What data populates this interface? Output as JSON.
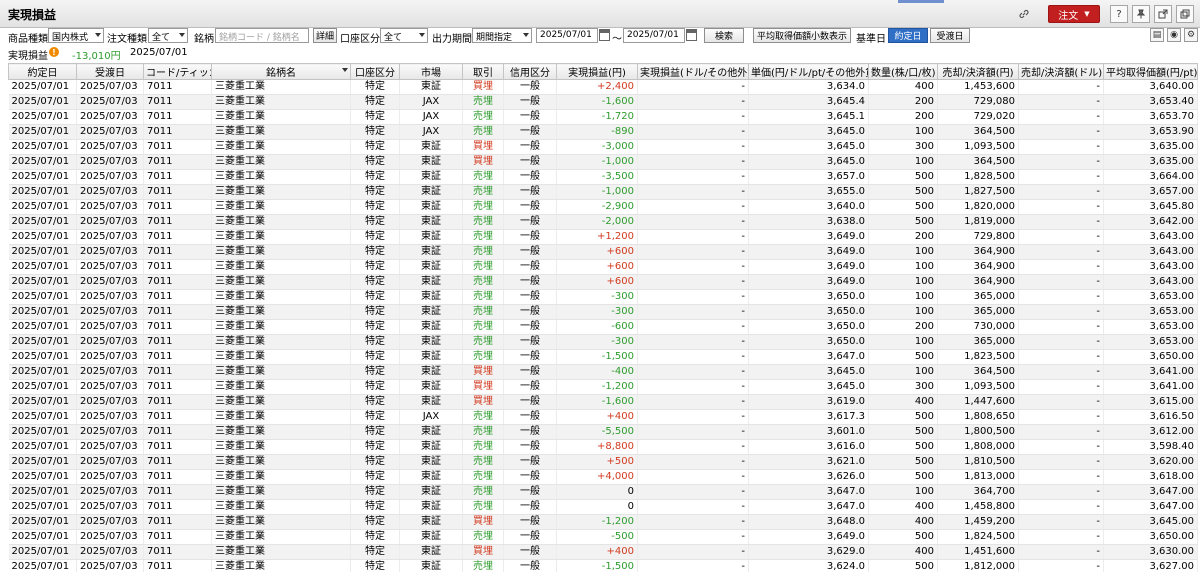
{
  "window": {
    "title": "実現損益"
  },
  "toolbar": {
    "order_label": "注文",
    "help_label": "?"
  },
  "filters": {
    "product_label": "商品種類",
    "product_value": "国内株式",
    "ordertype_label": "注文種類",
    "ordertype_value": "全て",
    "stock_label": "銘柄",
    "stock_placeholder": "銘柄コード / 銘柄名",
    "detail_label": "詳細",
    "account_label": "口座区分",
    "account_value": "全て",
    "period_label": "出力期間",
    "period_value": "期間指定",
    "date_from": "2025/07/01",
    "tilde": "～",
    "date_to": "2025/07/01",
    "search_label": "検索",
    "avgprice_label": "平均取得価額小数表示",
    "basedate_label": "基準日",
    "trade_date_label": "約定日",
    "settle_date_label": "受渡日"
  },
  "summary": {
    "label": "実現損益",
    "value": "-13,010円",
    "date": "2025/07/01"
  },
  "table": {
    "headers": [
      "約定日",
      "受渡日",
      "コード/ティッカー",
      "銘柄名",
      "口座区分",
      "市場",
      "取引",
      "信用区分",
      "実現損益(円)",
      "実現損益(ドル/その他外貨)",
      "単価(円/ドル/pt/その他外貨)",
      "数量(株/口/枚)",
      "売却/決済額(円)",
      "売却/決済額(ドル)",
      "平均取得価額(円/pt)"
    ],
    "rows": [
      [
        "2025/07/01",
        "2025/07/03",
        "7011",
        "三菱重工業",
        "特定",
        "東証",
        "買埋",
        "一般",
        "+2,400",
        "-",
        "3,634.0",
        "400",
        "1,453,600",
        "-",
        "3,640.00"
      ],
      [
        "2025/07/01",
        "2025/07/03",
        "7011",
        "三菱重工業",
        "特定",
        "JAX",
        "売埋",
        "一般",
        "-1,600",
        "-",
        "3,645.4",
        "200",
        "729,080",
        "-",
        "3,653.40"
      ],
      [
        "2025/07/01",
        "2025/07/03",
        "7011",
        "三菱重工業",
        "特定",
        "JAX",
        "売埋",
        "一般",
        "-1,720",
        "-",
        "3,645.1",
        "200",
        "729,020",
        "-",
        "3,653.70"
      ],
      [
        "2025/07/01",
        "2025/07/03",
        "7011",
        "三菱重工業",
        "特定",
        "JAX",
        "売埋",
        "一般",
        "-890",
        "-",
        "3,645.0",
        "100",
        "364,500",
        "-",
        "3,653.90"
      ],
      [
        "2025/07/01",
        "2025/07/03",
        "7011",
        "三菱重工業",
        "特定",
        "東証",
        "買埋",
        "一般",
        "-3,000",
        "-",
        "3,645.0",
        "300",
        "1,093,500",
        "-",
        "3,635.00"
      ],
      [
        "2025/07/01",
        "2025/07/03",
        "7011",
        "三菱重工業",
        "特定",
        "東証",
        "買埋",
        "一般",
        "-1,000",
        "-",
        "3,645.0",
        "100",
        "364,500",
        "-",
        "3,635.00"
      ],
      [
        "2025/07/01",
        "2025/07/03",
        "7011",
        "三菱重工業",
        "特定",
        "東証",
        "売埋",
        "一般",
        "-3,500",
        "-",
        "3,657.0",
        "500",
        "1,828,500",
        "-",
        "3,664.00"
      ],
      [
        "2025/07/01",
        "2025/07/03",
        "7011",
        "三菱重工業",
        "特定",
        "東証",
        "売埋",
        "一般",
        "-1,000",
        "-",
        "3,655.0",
        "500",
        "1,827,500",
        "-",
        "3,657.00"
      ],
      [
        "2025/07/01",
        "2025/07/03",
        "7011",
        "三菱重工業",
        "特定",
        "東証",
        "売埋",
        "一般",
        "-2,900",
        "-",
        "3,640.0",
        "500",
        "1,820,000",
        "-",
        "3,645.80"
      ],
      [
        "2025/07/01",
        "2025/07/03",
        "7011",
        "三菱重工業",
        "特定",
        "東証",
        "売埋",
        "一般",
        "-2,000",
        "-",
        "3,638.0",
        "500",
        "1,819,000",
        "-",
        "3,642.00"
      ],
      [
        "2025/07/01",
        "2025/07/03",
        "7011",
        "三菱重工業",
        "特定",
        "東証",
        "売埋",
        "一般",
        "+1,200",
        "-",
        "3,649.0",
        "200",
        "729,800",
        "-",
        "3,643.00"
      ],
      [
        "2025/07/01",
        "2025/07/03",
        "7011",
        "三菱重工業",
        "特定",
        "東証",
        "売埋",
        "一般",
        "+600",
        "-",
        "3,649.0",
        "100",
        "364,900",
        "-",
        "3,643.00"
      ],
      [
        "2025/07/01",
        "2025/07/03",
        "7011",
        "三菱重工業",
        "特定",
        "東証",
        "売埋",
        "一般",
        "+600",
        "-",
        "3,649.0",
        "100",
        "364,900",
        "-",
        "3,643.00"
      ],
      [
        "2025/07/01",
        "2025/07/03",
        "7011",
        "三菱重工業",
        "特定",
        "東証",
        "売埋",
        "一般",
        "+600",
        "-",
        "3,649.0",
        "100",
        "364,900",
        "-",
        "3,643.00"
      ],
      [
        "2025/07/01",
        "2025/07/03",
        "7011",
        "三菱重工業",
        "特定",
        "東証",
        "売埋",
        "一般",
        "-300",
        "-",
        "3,650.0",
        "100",
        "365,000",
        "-",
        "3,653.00"
      ],
      [
        "2025/07/01",
        "2025/07/03",
        "7011",
        "三菱重工業",
        "特定",
        "東証",
        "売埋",
        "一般",
        "-300",
        "-",
        "3,650.0",
        "100",
        "365,000",
        "-",
        "3,653.00"
      ],
      [
        "2025/07/01",
        "2025/07/03",
        "7011",
        "三菱重工業",
        "特定",
        "東証",
        "売埋",
        "一般",
        "-600",
        "-",
        "3,650.0",
        "200",
        "730,000",
        "-",
        "3,653.00"
      ],
      [
        "2025/07/01",
        "2025/07/03",
        "7011",
        "三菱重工業",
        "特定",
        "東証",
        "売埋",
        "一般",
        "-300",
        "-",
        "3,650.0",
        "100",
        "365,000",
        "-",
        "3,653.00"
      ],
      [
        "2025/07/01",
        "2025/07/03",
        "7011",
        "三菱重工業",
        "特定",
        "東証",
        "売埋",
        "一般",
        "-1,500",
        "-",
        "3,647.0",
        "500",
        "1,823,500",
        "-",
        "3,650.00"
      ],
      [
        "2025/07/01",
        "2025/07/03",
        "7011",
        "三菱重工業",
        "特定",
        "東証",
        "買埋",
        "一般",
        "-400",
        "-",
        "3,645.0",
        "100",
        "364,500",
        "-",
        "3,641.00"
      ],
      [
        "2025/07/01",
        "2025/07/03",
        "7011",
        "三菱重工業",
        "特定",
        "東証",
        "買埋",
        "一般",
        "-1,200",
        "-",
        "3,645.0",
        "300",
        "1,093,500",
        "-",
        "3,641.00"
      ],
      [
        "2025/07/01",
        "2025/07/03",
        "7011",
        "三菱重工業",
        "特定",
        "東証",
        "買埋",
        "一般",
        "-1,600",
        "-",
        "3,619.0",
        "400",
        "1,447,600",
        "-",
        "3,615.00"
      ],
      [
        "2025/07/01",
        "2025/07/03",
        "7011",
        "三菱重工業",
        "特定",
        "JAX",
        "売埋",
        "一般",
        "+400",
        "-",
        "3,617.3",
        "500",
        "1,808,650",
        "-",
        "3,616.50"
      ],
      [
        "2025/07/01",
        "2025/07/03",
        "7011",
        "三菱重工業",
        "特定",
        "東証",
        "売埋",
        "一般",
        "-5,500",
        "-",
        "3,601.0",
        "500",
        "1,800,500",
        "-",
        "3,612.00"
      ],
      [
        "2025/07/01",
        "2025/07/03",
        "7011",
        "三菱重工業",
        "特定",
        "東証",
        "売埋",
        "一般",
        "+8,800",
        "-",
        "3,616.0",
        "500",
        "1,808,000",
        "-",
        "3,598.40"
      ],
      [
        "2025/07/01",
        "2025/07/03",
        "7011",
        "三菱重工業",
        "特定",
        "東証",
        "売埋",
        "一般",
        "+500",
        "-",
        "3,621.0",
        "500",
        "1,810,500",
        "-",
        "3,620.00"
      ],
      [
        "2025/07/01",
        "2025/07/03",
        "7011",
        "三菱重工業",
        "特定",
        "東証",
        "売埋",
        "一般",
        "+4,000",
        "-",
        "3,626.0",
        "500",
        "1,813,000",
        "-",
        "3,618.00"
      ],
      [
        "2025/07/01",
        "2025/07/03",
        "7011",
        "三菱重工業",
        "特定",
        "東証",
        "売埋",
        "一般",
        "0",
        "-",
        "3,647.0",
        "100",
        "364,700",
        "-",
        "3,647.00"
      ],
      [
        "2025/07/01",
        "2025/07/03",
        "7011",
        "三菱重工業",
        "特定",
        "東証",
        "売埋",
        "一般",
        "0",
        "-",
        "3,647.0",
        "400",
        "1,458,800",
        "-",
        "3,647.00"
      ],
      [
        "2025/07/01",
        "2025/07/03",
        "7011",
        "三菱重工業",
        "特定",
        "東証",
        "買埋",
        "一般",
        "-1,200",
        "-",
        "3,648.0",
        "400",
        "1,459,200",
        "-",
        "3,645.00"
      ],
      [
        "2025/07/01",
        "2025/07/03",
        "7011",
        "三菱重工業",
        "特定",
        "東証",
        "売埋",
        "一般",
        "-500",
        "-",
        "3,649.0",
        "500",
        "1,824,500",
        "-",
        "3,650.00"
      ],
      [
        "2025/07/01",
        "2025/07/03",
        "7011",
        "三菱重工業",
        "特定",
        "東証",
        "買埋",
        "一般",
        "+400",
        "-",
        "3,629.0",
        "400",
        "1,451,600",
        "-",
        "3,630.00"
      ],
      [
        "2025/07/01",
        "2025/07/03",
        "7011",
        "三菱重工業",
        "特定",
        "東証",
        "売埋",
        "一般",
        "-1,500",
        "-",
        "3,624.0",
        "500",
        "1,812,000",
        "-",
        "3,627.00"
      ]
    ]
  },
  "colors": {
    "order_red": "#c22020",
    "buy_red": "#d23a1f",
    "sell_green": "#2e9c2e",
    "active_blue": "#2f6fc6"
  }
}
